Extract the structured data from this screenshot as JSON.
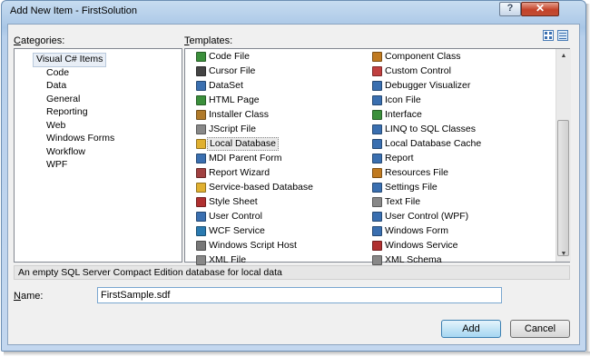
{
  "window": {
    "title": "Add New Item - FirstSolution",
    "help_symbol": "?",
    "close_symbol": "✕"
  },
  "categories": {
    "label_prefix": "C",
    "label_rest": "ategories:",
    "items": [
      {
        "label": "Visual C# Items",
        "selected": true
      },
      {
        "label": "Code"
      },
      {
        "label": "Data"
      },
      {
        "label": "General"
      },
      {
        "label": "Reporting"
      },
      {
        "label": "Web"
      },
      {
        "label": "Windows Forms"
      },
      {
        "label": "Workflow"
      },
      {
        "label": "WPF"
      }
    ]
  },
  "templates": {
    "label_prefix": "T",
    "label_rest": "emplates:",
    "left_column": [
      {
        "label": "Code File",
        "icon": "code-file-icon",
        "color": "#3b8f3b"
      },
      {
        "label": "Cursor File",
        "icon": "cursor-file-icon",
        "color": "#444444"
      },
      {
        "label": "DataSet",
        "icon": "dataset-icon",
        "color": "#3a6fb0"
      },
      {
        "label": "HTML Page",
        "icon": "html-page-icon",
        "color": "#3b8f3b"
      },
      {
        "label": "Installer Class",
        "icon": "installer-class-icon",
        "color": "#b07a2a"
      },
      {
        "label": "JScript File",
        "icon": "jscript-file-icon",
        "color": "#888888"
      },
      {
        "label": "Local Database",
        "icon": "local-database-icon",
        "color": "#e0b030",
        "selected": true
      },
      {
        "label": "MDI Parent Form",
        "icon": "mdi-parent-form-icon",
        "color": "#3a6fb0"
      },
      {
        "label": "Report Wizard",
        "icon": "report-wizard-icon",
        "color": "#a04040"
      },
      {
        "label": "Service-based Database",
        "icon": "service-database-icon",
        "color": "#e0b030"
      },
      {
        "label": "Style Sheet",
        "icon": "style-sheet-icon",
        "color": "#b03030"
      },
      {
        "label": "User Control",
        "icon": "user-control-icon",
        "color": "#3a6fb0"
      },
      {
        "label": "WCF Service",
        "icon": "wcf-service-icon",
        "color": "#2a7ab0"
      },
      {
        "label": "Windows Script Host",
        "icon": "windows-script-host-icon",
        "color": "#777777"
      },
      {
        "label": "XML File",
        "icon": "xml-file-icon",
        "color": "#888888"
      }
    ],
    "right_column": [
      {
        "label": "Component Class",
        "icon": "component-class-icon",
        "color": "#c07a20"
      },
      {
        "label": "Custom Control",
        "icon": "custom-control-icon",
        "color": "#c04040"
      },
      {
        "label": "Debugger Visualizer",
        "icon": "debugger-visualizer-icon",
        "color": "#3a6fb0"
      },
      {
        "label": "Icon File",
        "icon": "icon-file-icon",
        "color": "#3a6fb0"
      },
      {
        "label": "Interface",
        "icon": "interface-icon",
        "color": "#3b8f3b"
      },
      {
        "label": "LINQ to SQL Classes",
        "icon": "linq-sql-icon",
        "color": "#3a6fb0"
      },
      {
        "label": "Local Database Cache",
        "icon": "local-database-cache-icon",
        "color": "#3a6fb0"
      },
      {
        "label": "Report",
        "icon": "report-icon",
        "color": "#3a6fb0"
      },
      {
        "label": "Resources File",
        "icon": "resources-file-icon",
        "color": "#c07a20"
      },
      {
        "label": "Settings File",
        "icon": "settings-file-icon",
        "color": "#3a6fb0"
      },
      {
        "label": "Text File",
        "icon": "text-file-icon",
        "color": "#888888"
      },
      {
        "label": "User Control (WPF)",
        "icon": "user-control-wpf-icon",
        "color": "#3a6fb0"
      },
      {
        "label": "Windows Form",
        "icon": "windows-form-icon",
        "color": "#3a6fb0"
      },
      {
        "label": "Windows Service",
        "icon": "windows-service-icon",
        "color": "#b03030"
      },
      {
        "label": "XML Schema",
        "icon": "xml-schema-icon",
        "color": "#888888"
      }
    ]
  },
  "description": "An empty SQL Server Compact Edition database for local data",
  "name_field": {
    "label_prefix": "N",
    "label_rest": "ame:",
    "value": "FirstSample.sdf"
  },
  "buttons": {
    "add": "Add",
    "cancel": "Cancel"
  }
}
